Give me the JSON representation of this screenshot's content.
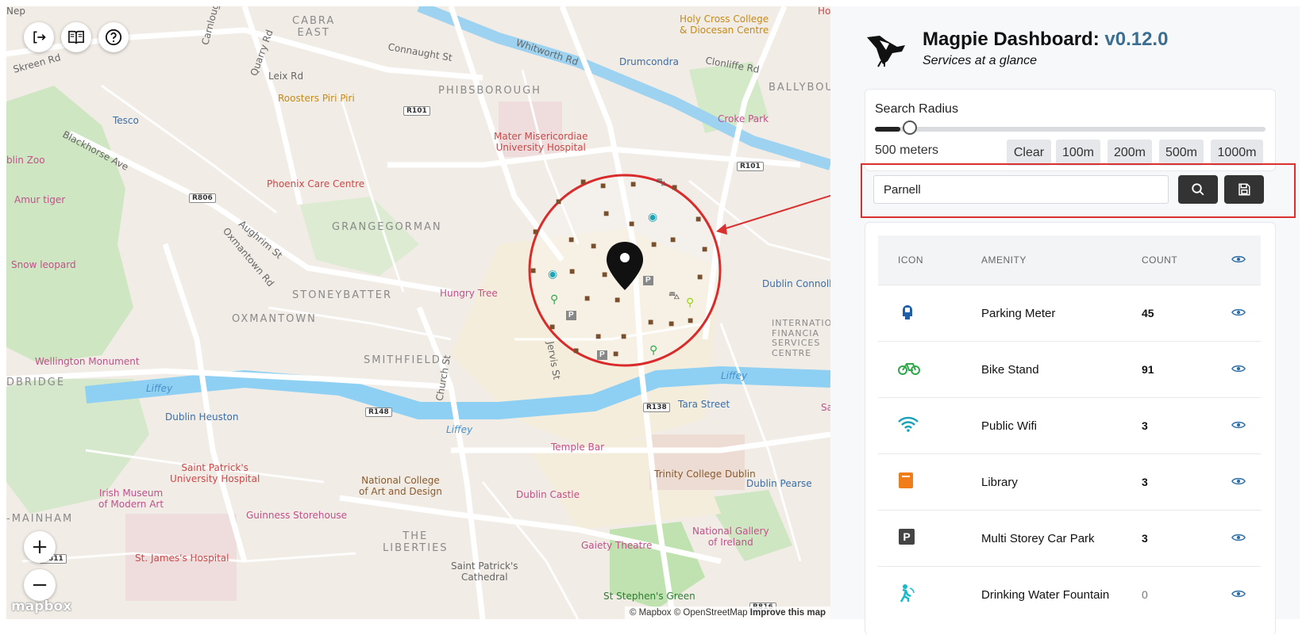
{
  "map": {
    "attribution": "© Mapbox © OpenStreetMap",
    "improve_link": "Improve this map",
    "logo_text": "mapbox",
    "zoom_in": "+",
    "zoom_out": "−",
    "search_location": "Parnell",
    "labels": {
      "cabra_east": "CABRA\nEAST",
      "phibsborough": "PHIBSBOROUGH",
      "grangegorman": "GRANGEGORMAN",
      "stoneybatter": "STONEYBATTER",
      "oxmantown": "OXMANTOWN",
      "smithfield": "SMITHFIELD",
      "the_liberties": "THE\nLIBERTIES",
      "ballybough": "BALLYBOUGH",
      "ifsc": "INTERNATIO\nFINANCIA\nSERVICES\nCENTRE",
      "mainham": "-MAINHAM",
      "dbridge": "DBRIDGE",
      "holy_cross": "Holy Cross College\n& Diocesan Centre",
      "drumcondra": "Drumcondra",
      "croke_park": "Croke Park",
      "mater": "Mater Misericordiae\nUniversity Hospital",
      "phoenix": "Phoenix Care Centre",
      "roosters": "Roosters Piri Piri",
      "tesco": "Tesco",
      "dublin_zoo": "blin Zoo",
      "amur_tiger": "Amur tiger",
      "snow_leopard": "Snow leopard",
      "hungry_tree": "Hungry Tree",
      "wellington": "Wellington Monument",
      "dublin_heuston": "Dublin Heuston",
      "st_patricks": "Saint Patrick's\nUniversity Hospital",
      "imma": "Irish Museum\nof Modern Art",
      "guinness": "Guinness Storehouse",
      "st_james": "St. James's Hospital",
      "ncad": "National College\nof Art and Design",
      "temple_bar": "Temple Bar",
      "dublin_castle": "Dublin Castle",
      "trinity": "Trinity College Dublin",
      "dublin_pearse": "Dublin Pearse",
      "tara_street": "Tara Street",
      "dublin_connolly": "Dublin Connolly",
      "national_gallery": "National Gallery\nof Ireland",
      "gaiety": "Gaiety Theatre",
      "stephens_green": "St Stephen's Green",
      "st_patricks_cathedral": "Saint Patrick's\nCathedral",
      "liffey1": "Liffey",
      "liffey2": "Liffey",
      "liffey3": "Liffey",
      "whitworth": "Whitworth Rd",
      "connaught": "Connaught St",
      "clonliffe": "Clonliffe Rd",
      "quarry": "Quarry Rd",
      "leix": "Leix Rd",
      "blackhorse": "Blackhorse Ave",
      "aughrim": "Aughrim St",
      "oxmantown_rd": "Oxmantown Rd",
      "church_st": "Church St",
      "jervis_st": "Jervis St",
      "skreen": "Skreen Rd",
      "carnlough": "Carnlough",
      "nep": "Nep",
      "r101a": "R101",
      "r101b": "R101",
      "r806": "R806",
      "r148": "R148",
      "r138": "R138",
      "r811": "R811",
      "r816": "R816",
      "ho": "Ho",
      "sa": "Sa"
    }
  },
  "header": {
    "title": "Magpie Dashboard:",
    "version": "v0.12.0",
    "subtitle": "Services at a glance"
  },
  "radius": {
    "label": "Search Radius",
    "value_text": "500 meters",
    "slider_fraction": 0.065,
    "presets": [
      "Clear",
      "100m",
      "200m",
      "500m",
      "1000m"
    ]
  },
  "search": {
    "value": "Parnell"
  },
  "table": {
    "headers": {
      "icon": "ICON",
      "amenity": "AMENITY",
      "count": "COUNT"
    },
    "rows": [
      {
        "amenity": "Parking Meter",
        "count": "45",
        "icon": "parking-meter-icon",
        "color": "#1f5fa8"
      },
      {
        "amenity": "Bike Stand",
        "count": "91",
        "icon": "bike-icon",
        "color": "#2fa84a"
      },
      {
        "amenity": "Public Wifi",
        "count": "3",
        "icon": "wifi-icon",
        "color": "#1ba3b8"
      },
      {
        "amenity": "Library",
        "count": "3",
        "icon": "book-icon",
        "color": "#f07d1a"
      },
      {
        "amenity": "Multi Storey Car Park",
        "count": "3",
        "icon": "parking-icon",
        "color": "#444444"
      },
      {
        "amenity": "Drinking Water Fountain",
        "count": "0",
        "icon": "fountain-icon",
        "color": "#1bb8c8"
      }
    ]
  },
  "colors": {
    "accent": "#3b6e91",
    "annotation": "#d93030",
    "button_dark": "#333333"
  }
}
